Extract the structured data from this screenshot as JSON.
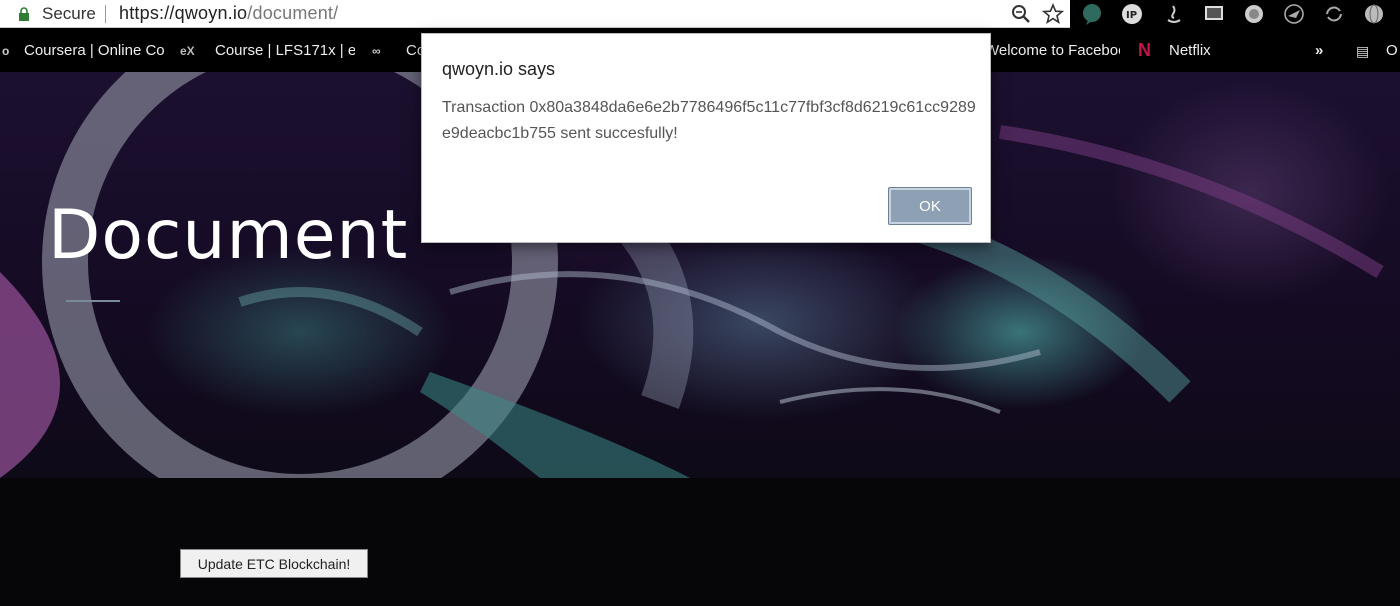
{
  "browser": {
    "secure_label": "Secure",
    "url_host": "https://qwoyn.io",
    "url_path": "/document/"
  },
  "bookmarks": [
    {
      "label": "Coursera | Online Co"
    },
    {
      "label": "Course | LFS171x | e"
    },
    {
      "label": "Co"
    },
    {
      "label": "Welcome to Faceboo"
    },
    {
      "label": "Netflix"
    },
    {
      "label": "»"
    },
    {
      "label": "O"
    }
  ],
  "hero": {
    "title": "Document"
  },
  "main": {
    "update_button": "Update ETC Blockchain!"
  },
  "dialog": {
    "title": "qwoyn.io says",
    "message": "Transaction 0x80a3848da6e6e2b7786496f5c11c77fbf3cf8d6219c61cc9289e9deacbc1b755 sent succesfully!",
    "ok_label": "OK"
  },
  "colors": {
    "ok_button": "#8da0b4",
    "hero_teal": "#3f8f8f",
    "hero_purple": "#6a3a7a"
  }
}
